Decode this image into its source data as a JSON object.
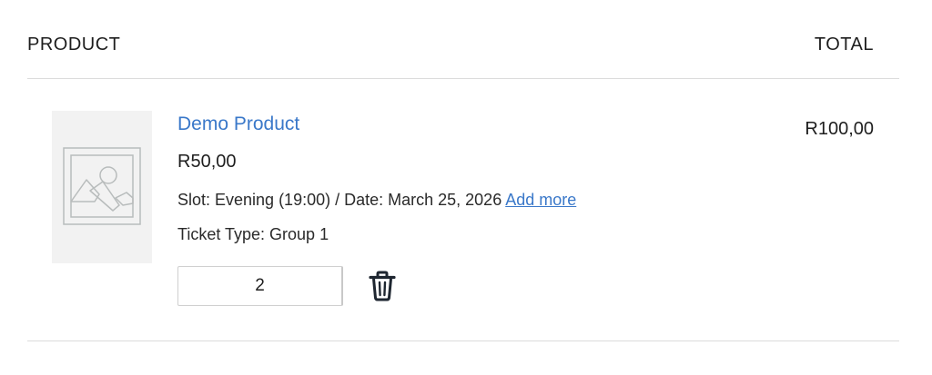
{
  "table": {
    "product_header": "PRODUCT",
    "total_header": "TOTAL"
  },
  "item": {
    "name": "Demo Product",
    "unit_price": "R50,00",
    "slot_text": "Slot: Evening (19:00) / Date: March 25, 2026",
    "add_more_label": "Add more",
    "ticket_type_text": "Ticket Type: Group 1",
    "quantity": "2",
    "line_total": "R100,00",
    "thumbnail_icon": "image-placeholder-icon",
    "remove_icon": "trash-icon"
  },
  "colors": {
    "link": "#3a78c9",
    "divider": "#dcdcdc",
    "thumb_bg": "#f2f2f2"
  }
}
